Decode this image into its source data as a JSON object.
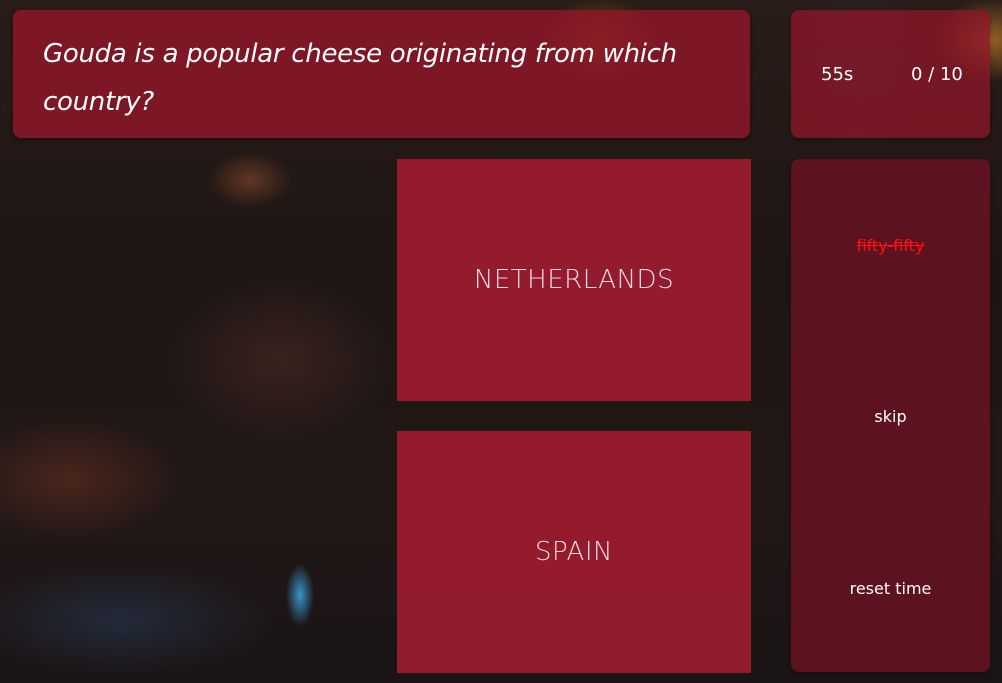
{
  "question": {
    "text": "Gouda is a popular cheese originating from which country?"
  },
  "status": {
    "timer": "55s",
    "score": "0 / 10"
  },
  "answers": [
    {
      "label": "NETHERLANDS"
    },
    {
      "label": "SPAIN"
    }
  ],
  "lifelines": {
    "fifty_fifty": {
      "label": "fifty-fifty",
      "used": true
    },
    "skip": {
      "label": "skip"
    },
    "reset_time": {
      "label": "reset time"
    }
  },
  "colors": {
    "panel": "#8c1628",
    "answer": "#a01c30",
    "used_lifeline": "#ff1010"
  }
}
